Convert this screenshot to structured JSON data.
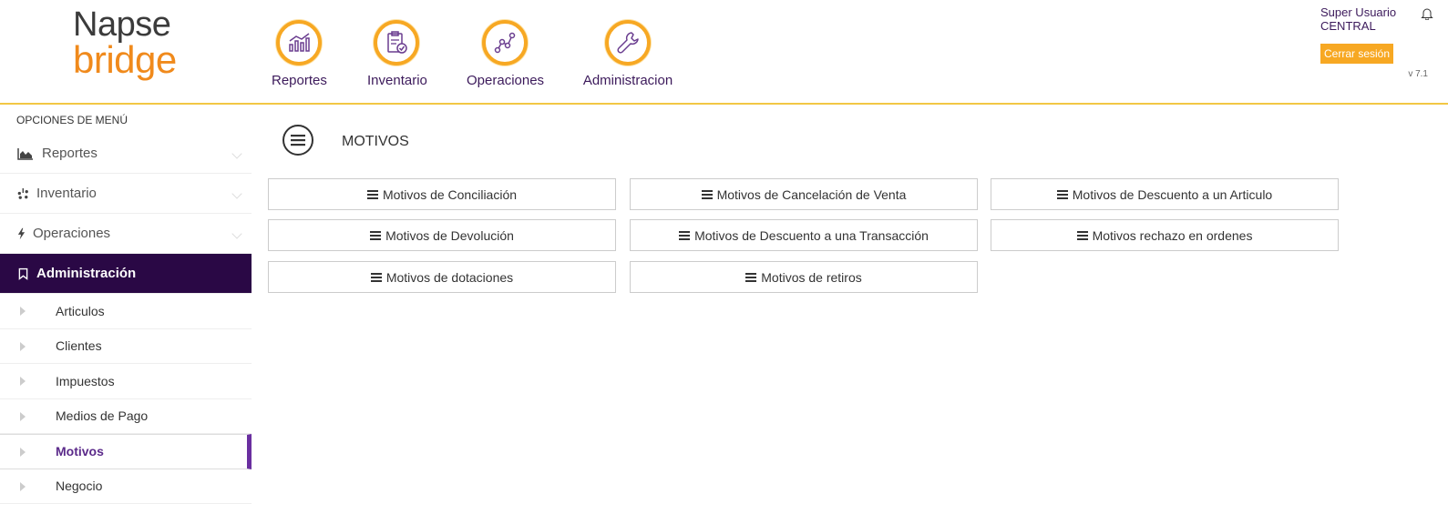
{
  "brand": {
    "line1": "Napse",
    "line2": "bridge"
  },
  "topnav": [
    {
      "label": "Reportes",
      "icon": "chart-icon"
    },
    {
      "label": "Inventario",
      "icon": "clipboard-check-icon"
    },
    {
      "label": "Operaciones",
      "icon": "network-nodes-icon"
    },
    {
      "label": "Administracion",
      "icon": "wrench-icon"
    }
  ],
  "user": {
    "name": "Super Usuario",
    "store": "CENTRAL",
    "logout": "Cerrar sesión",
    "version": "v 7.1"
  },
  "sidebar": {
    "title": "OPCIONES DE MENÚ",
    "items": [
      {
        "label": "Reportes",
        "icon": "area-chart-icon"
      },
      {
        "label": "Inventario",
        "icon": "yelp-icon"
      },
      {
        "label": "Operaciones",
        "icon": "bolt-icon"
      },
      {
        "label": "Administración",
        "icon": "bookmark-icon"
      }
    ],
    "subitems": [
      "Articulos",
      "Clientes",
      "Impuestos",
      "Medios de Pago",
      "Motivos",
      "Negocio"
    ]
  },
  "main": {
    "title": "MOTIVOS",
    "buttons": [
      "Motivos de Conciliación",
      "Motivos de Cancelación de Venta",
      "Motivos de Descuento a un Articulo",
      "Motivos de Devolución",
      "Motivos de Descuento a una Transacción",
      "Motivos rechazo en ordenes",
      "Motivos de dotaciones",
      "Motivos de retiros"
    ]
  },
  "colors": {
    "accent": "#f7a823",
    "sidebar_active": "#2a0845",
    "header_border": "#f2c744",
    "brand_purple": "#3c1a5b"
  }
}
